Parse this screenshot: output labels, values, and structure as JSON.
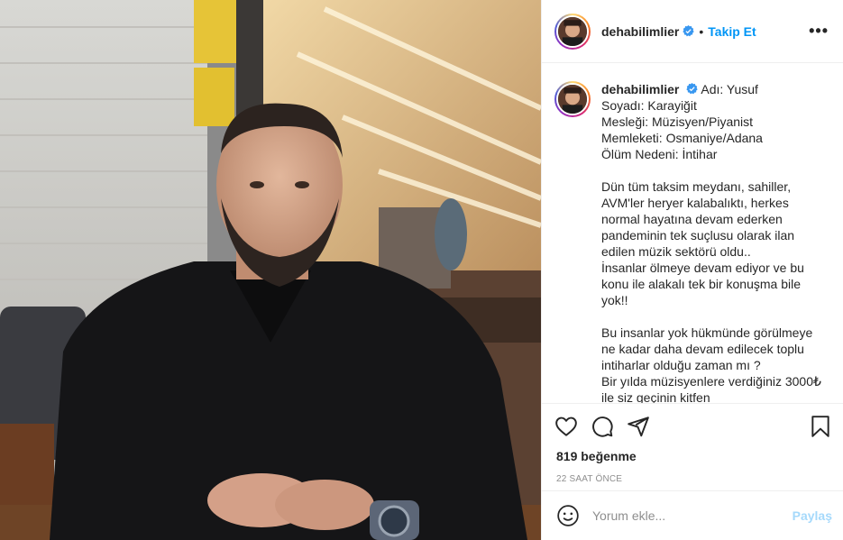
{
  "post": {
    "username": "dehabilimlier",
    "separator": "•",
    "follow_label": "Takip Et",
    "more_label": "•••",
    "caption_lines": [
      "Adı: Yusuf",
      "Soyadı: Karayiğit",
      "Mesleği: Müzisyen/Piyanist",
      "Memleketi: Osmaniye/Adana",
      "Ölüm Nedeni: İntihar",
      "",
      "Dün tüm taksim meydanı, sahiller,",
      "AVM'ler heryer kalabalıktı, herkes",
      "normal hayatına devam ederken",
      "pandeminin tek suçlusu olarak ilan",
      "edilen müzik sektörü oldu..",
      "İnsanlar ölmeye devam ediyor ve bu",
      "konu ile alakalı tek bir konuşma bile",
      "yok!!",
      "",
      "Bu insanlar yok hükmünde görülmeye",
      "ne kadar daha devam edilecek toplu",
      "intiharlar olduğu zaman mı ?",
      "Bir yılda müzisyenlere verdiğiniz 3000₺",
      "ile siz geçinin kitfen"
    ],
    "likes": "819 beğenme",
    "time": "22 SAAT ÖNCE",
    "comment_placeholder": "Yorum ekle...",
    "post_label": "Paylaş",
    "colors": {
      "accent": "#0095f6",
      "muted": "#8e8e8e",
      "text": "#262626"
    },
    "icons": [
      "verified-icon",
      "heart-icon",
      "comment-icon",
      "share-icon",
      "bookmark-icon",
      "emoji-icon"
    ]
  }
}
